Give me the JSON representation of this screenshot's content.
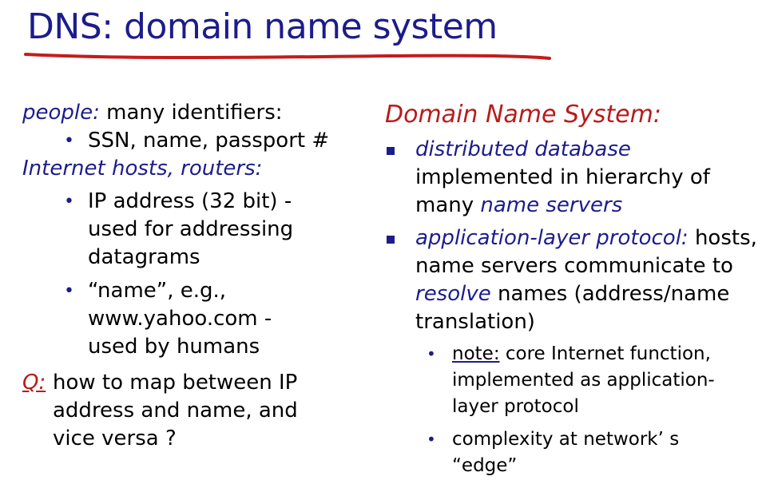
{
  "title": "DNS: domain name system",
  "colors": {
    "title": "#1c1c8c",
    "accent_red": "#b81b1b",
    "bullet": "#1c1c8c"
  },
  "left": {
    "people_label": "people:",
    "people_text": " many identifiers:",
    "people_bullet": "SSN, name, passport #",
    "hosts_label": "Internet hosts, routers:",
    "hosts_bullets": [
      [
        "IP address (32 bit) -",
        "used for addressing",
        "datagrams"
      ],
      [
        "“name”, e.g.,",
        "www.yahoo.com -",
        "used by humans"
      ]
    ],
    "q_label": "Q:",
    "q_lines": [
      "how to map between IP",
      "address and name, and",
      "vice versa ?"
    ]
  },
  "right": {
    "heading": "Domain Name System:",
    "item1_italic": "distributed database",
    "item1_line2": "implemented in hierarchy of",
    "item1_line3_a": "many ",
    "item1_line3_b": "name servers",
    "item2_italic": "application-layer protocol:",
    "item2_a": " hosts,",
    "item2_line2": "name servers communicate to",
    "item2_line3_italic": "resolve",
    "item2_line3_rest": " names (address/name",
    "item2_line4": "translation)",
    "sub1_label": "note:",
    "sub1_rest": " core Internet function,",
    "sub1_line2": "implemented as application-",
    "sub1_line3": "layer protocol",
    "sub2_line1": "complexity at network’ s",
    "sub2_line2": "“edge”"
  }
}
